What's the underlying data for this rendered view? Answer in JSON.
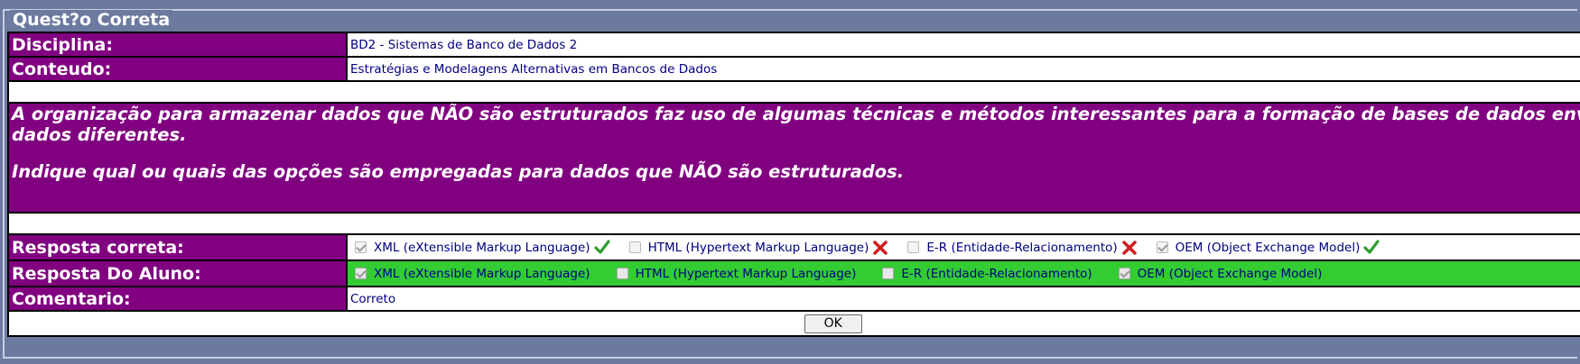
{
  "legend": "Quest?o Correta",
  "rows": {
    "disciplina": {
      "label": "Disciplina:",
      "value": "BD2 - Sistemas de Banco de Dados 2"
    },
    "conteudo": {
      "label": "Conteudo:",
      "value": "Estratégias e Modelagens Alternativas em Bancos de Dados"
    }
  },
  "question": {
    "line1": "A organização para armazenar dados que NÃO são estruturados faz uso de algumas técnicas e métodos interessantes para a formação de bases de dados envolvend",
    "line2": "dados diferentes.",
    "line3": "Indique  qual ou quais das opções são empregadas para dados que NÃO são estruturados."
  },
  "correct_answer": {
    "label": "Resposta correta:",
    "options": [
      {
        "text": "XML (eXtensible Markup Language)",
        "checked": true,
        "mark": "check-icon"
      },
      {
        "text": "HTML (Hypertext Markup Language)",
        "checked": false,
        "mark": "cross-icon"
      },
      {
        "text": "E-R (Entidade-Relacionamento)",
        "checked": false,
        "mark": "cross-icon"
      },
      {
        "text": "OEM (Object Exchange Model)",
        "checked": true,
        "mark": "check-icon"
      }
    ]
  },
  "student_answer": {
    "label": "Resposta Do Aluno:",
    "highlight_color": "#33cc33",
    "options": [
      {
        "text": "XML (eXtensible Markup Language)",
        "checked": true
      },
      {
        "text": "HTML (Hypertext Markup Language)",
        "checked": false
      },
      {
        "text": "E-R (Entidade-Relacionamento)",
        "checked": false
      },
      {
        "text": "OEM (Object Exchange Model)",
        "checked": true
      }
    ]
  },
  "comment": {
    "label": "Comentario:",
    "value": "Correto"
  },
  "ok_button": "OK",
  "colors": {
    "label_bg": "#800080",
    "page_bg": "#6c7aa0",
    "value_text": "#000080"
  }
}
